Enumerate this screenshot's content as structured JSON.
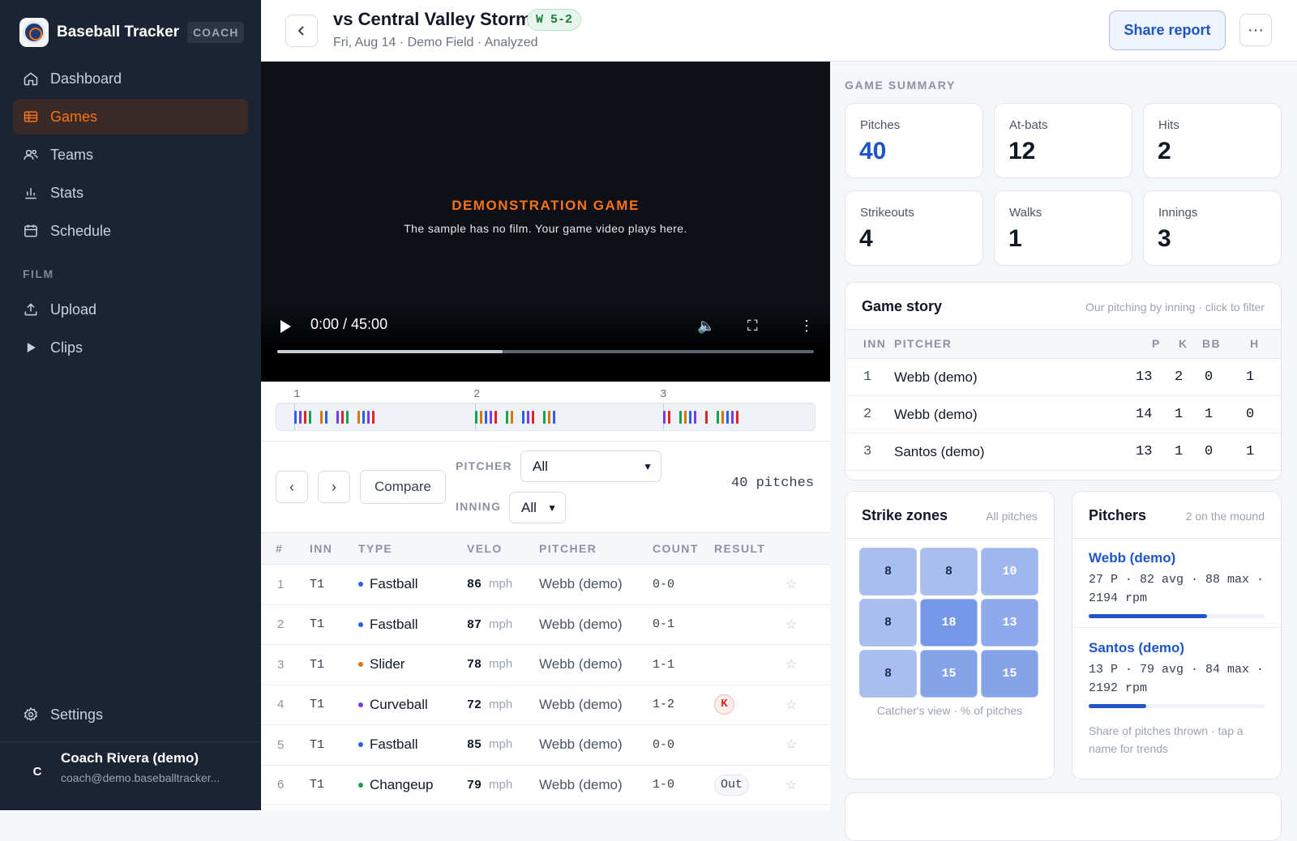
{
  "app": {
    "name": "Baseball Tracker",
    "role_badge": "COACH"
  },
  "nav": {
    "items": [
      {
        "label": "Dashboard",
        "icon": "home-icon"
      },
      {
        "label": "Games",
        "icon": "table-icon",
        "active": true
      },
      {
        "label": "Teams",
        "icon": "users-icon"
      },
      {
        "label": "Stats",
        "icon": "bar-chart-icon"
      },
      {
        "label": "Schedule",
        "icon": "calendar-icon"
      }
    ],
    "film_section": "FILM",
    "film_items": [
      {
        "label": "Upload",
        "icon": "upload-icon"
      },
      {
        "label": "Clips",
        "icon": "play-icon"
      }
    ],
    "settings": "Settings"
  },
  "user": {
    "initial": "C",
    "name": "Coach Rivera (demo)",
    "email": "coach@demo.baseballtracker..."
  },
  "game": {
    "title": "vs Central Valley Storm",
    "result": "W 5-2",
    "subtitle": "Fri, Aug 14 · Demo Field · Analyzed",
    "share_label": "Share report",
    "more_label": "···"
  },
  "video": {
    "title": "DEMONSTRATION GAME",
    "subtitle": "The sample has no film. Your game video plays here.",
    "time": "0:00 / 45:00",
    "progress": 0.42
  },
  "timeline": {
    "innings": [
      "1",
      "2",
      "3"
    ]
  },
  "controls": {
    "prev": "‹",
    "next": "›",
    "compare": "Compare",
    "pitcher_label": "PITCHER",
    "pitcher_value": "All",
    "inning_label": "INNING",
    "inning_value": "All",
    "count_text": "40 pitches"
  },
  "pitch_table": {
    "headers": [
      "#",
      "INN",
      "TYPE",
      "VELO",
      "PITCHER",
      "COUNT",
      "RESULT"
    ],
    "unit": "mph",
    "rows": [
      {
        "num": "1",
        "inn": "T1",
        "type": "Fastball",
        "color": "#2563eb",
        "velo": "86",
        "pitcher": "Webb (demo)",
        "count": "0-0",
        "result": ""
      },
      {
        "num": "2",
        "inn": "T1",
        "type": "Fastball",
        "color": "#2563eb",
        "velo": "87",
        "pitcher": "Webb (demo)",
        "count": "0-1",
        "result": ""
      },
      {
        "num": "3",
        "inn": "T1",
        "type": "Slider",
        "color": "#d97706",
        "velo": "78",
        "pitcher": "Webb (demo)",
        "count": "1-1",
        "result": ""
      },
      {
        "num": "4",
        "inn": "T1",
        "type": "Curveball",
        "color": "#7c3aed",
        "velo": "72",
        "pitcher": "Webb (demo)",
        "count": "1-2",
        "result": "K"
      },
      {
        "num": "5",
        "inn": "T1",
        "type": "Fastball",
        "color": "#2563eb",
        "velo": "85",
        "pitcher": "Webb (demo)",
        "count": "0-0",
        "result": ""
      },
      {
        "num": "6",
        "inn": "T1",
        "type": "Changeup",
        "color": "#16a34a",
        "velo": "79",
        "pitcher": "Webb (demo)",
        "count": "1-0",
        "result": "Out"
      }
    ]
  },
  "summary": {
    "title": "GAME SUMMARY",
    "stats": [
      {
        "label": "Pitches",
        "value": "40",
        "accent": true
      },
      {
        "label": "At-bats",
        "value": "12"
      },
      {
        "label": "Hits",
        "value": "2"
      },
      {
        "label": "Strikeouts",
        "value": "4"
      },
      {
        "label": "Walks",
        "value": "1"
      },
      {
        "label": "Innings",
        "value": "3"
      }
    ]
  },
  "story": {
    "title": "Game story",
    "hint": "Our pitching by inning · click to filter",
    "headers": {
      "inn": "INN",
      "pitcher": "PITCHER",
      "p": "P",
      "k": "K",
      "bb": "BB",
      "h": "H"
    },
    "rows": [
      {
        "inn": "1",
        "pitcher": "Webb (demo)",
        "p": "13",
        "k": "2",
        "bb": "0",
        "h": "1"
      },
      {
        "inn": "2",
        "pitcher": "Webb (demo)",
        "p": "14",
        "k": "1",
        "bb": "1",
        "h": "0"
      },
      {
        "inn": "3",
        "pitcher": "Santos (demo)",
        "p": "13",
        "k": "1",
        "bb": "0",
        "h": "1"
      }
    ]
  },
  "zones": {
    "title": "Strike zones",
    "hint": "All pitches",
    "values": [
      "8",
      "8",
      "10",
      "8",
      "18",
      "13",
      "8",
      "15",
      "15"
    ],
    "caption": "Catcher's view · % of pitches"
  },
  "pitchers": {
    "title": "Pitchers",
    "hint": "2 on the mound",
    "items": [
      {
        "name": "Webb (demo)",
        "stats": "27 P · 82 avg · 88 max · 2194 rpm",
        "share": 0.675
      },
      {
        "name": "Santos (demo)",
        "stats": "13 P · 79 avg · 84 max · 2192 rpm",
        "share": 0.325
      }
    ],
    "caption": "Share of pitches thrown · tap a name for trends"
  }
}
